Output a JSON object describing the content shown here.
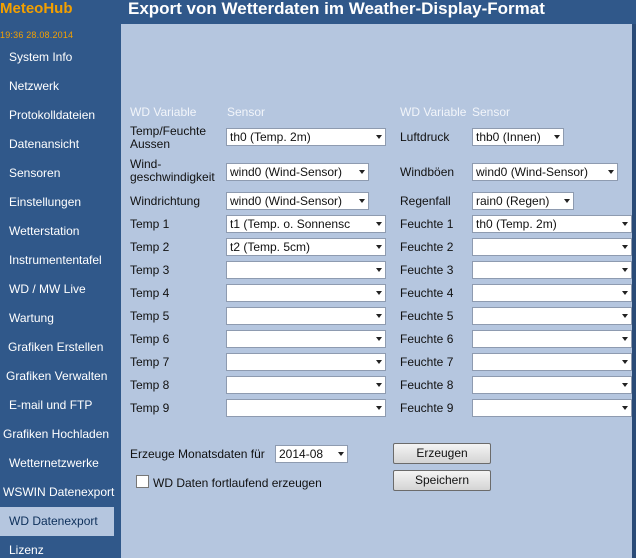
{
  "app": {
    "logo": "MeteoHub",
    "clock": "19:36   28.08.2014",
    "page_title": "Export von Wetterdaten im Weather-Display-Format"
  },
  "sidebar": {
    "items": [
      {
        "label": "System Info",
        "active": false
      },
      {
        "label": "Netzwerk",
        "active": false
      },
      {
        "label": "Protokolldateien",
        "active": false
      },
      {
        "label": "Datenansicht",
        "active": false
      },
      {
        "label": "Sensoren",
        "active": false
      },
      {
        "label": "Einstellungen",
        "active": false
      },
      {
        "label": "Wetterstation",
        "active": false
      },
      {
        "label": "Instrumententafel",
        "active": false
      },
      {
        "label": "WD / MW Live",
        "active": false
      },
      {
        "label": "Wartung",
        "active": false
      },
      {
        "label": "Grafiken Erstellen",
        "active": false
      },
      {
        "label": "Grafiken Verwalten",
        "active": false
      },
      {
        "label": "E-mail und FTP",
        "active": false
      },
      {
        "label": "Grafiken Hochladen",
        "active": false
      },
      {
        "label": "Wetternetzwerke",
        "active": false
      },
      {
        "label": "WSWIN Datenexport",
        "active": false
      },
      {
        "label": "WD Datenexport",
        "active": true
      },
      {
        "label": "Lizenz",
        "active": false
      }
    ]
  },
  "table": {
    "header_variable": "WD Variable",
    "header_sensor": "Sensor",
    "temp_aussen_label_line1": "Temp/Feuchte",
    "temp_aussen_label_line2": "Aussen",
    "temp_aussen_value": "th0 (Temp. 2m)",
    "luftdruck_label": "Luftdruck",
    "luftdruck_value": "thb0 (Innen)",
    "windgeschw_label_line1": "Wind-",
    "windgeschw_label_line2": "geschwindigkeit",
    "windgeschw_value": "wind0 (Wind-Sensor)",
    "windboeen_label": "Windböen",
    "windboeen_value": "wind0 (Wind-Sensor)",
    "windrichtung_label": "Windrichtung",
    "windrichtung_value": "wind0 (Wind-Sensor)",
    "regenfall_label": "Regenfall",
    "regenfall_value": "rain0 (Regen)",
    "temps": [
      {
        "label": "Temp 1",
        "value": "t1 (Temp. o. Sonnensc"
      },
      {
        "label": "Temp 2",
        "value": "t2 (Temp. 5cm)"
      },
      {
        "label": "Temp 3",
        "value": ""
      },
      {
        "label": "Temp 4",
        "value": ""
      },
      {
        "label": "Temp 5",
        "value": ""
      },
      {
        "label": "Temp 6",
        "value": ""
      },
      {
        "label": "Temp 7",
        "value": ""
      },
      {
        "label": "Temp 8",
        "value": ""
      },
      {
        "label": "Temp 9",
        "value": ""
      }
    ],
    "feuchten": [
      {
        "label": "Feuchte 1",
        "value": "th0 (Temp. 2m)"
      },
      {
        "label": "Feuchte 2",
        "value": ""
      },
      {
        "label": "Feuchte 3",
        "value": ""
      },
      {
        "label": "Feuchte 4",
        "value": ""
      },
      {
        "label": "Feuchte 5",
        "value": ""
      },
      {
        "label": "Feuchte 6",
        "value": ""
      },
      {
        "label": "Feuchte 7",
        "value": ""
      },
      {
        "label": "Feuchte 8",
        "value": ""
      },
      {
        "label": "Feuchte 9",
        "value": ""
      }
    ]
  },
  "export": {
    "month_label": "Erzeuge Monatsdaten für",
    "month_value": "2014-08",
    "create_button": "Erzeugen",
    "continuous_label": "WD Daten fortlaufend erzeugen",
    "continuous_checked": false,
    "save_button": "Speichern"
  },
  "colors": {
    "sidebar_bg": "#30588a",
    "content_bg": "#b5c6df",
    "logo_orange": "#f3a000"
  }
}
